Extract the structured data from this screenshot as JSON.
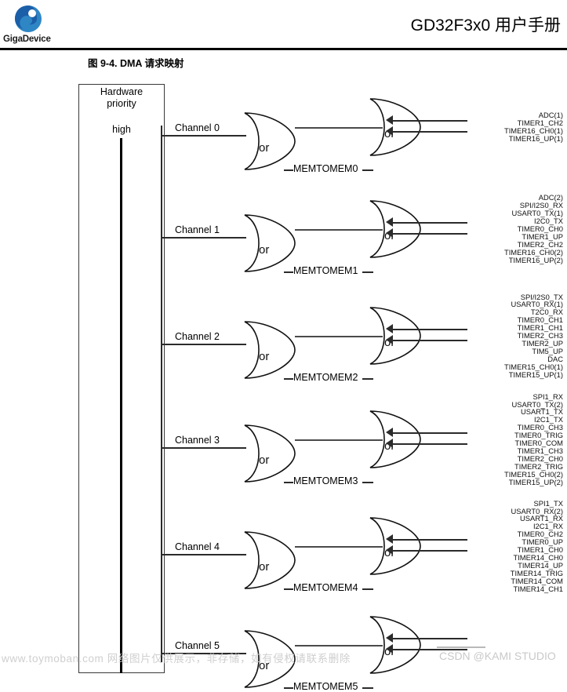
{
  "header": {
    "logo_name": "GigaDevice",
    "logo_icon": "gigadevice-swirl-logo",
    "doc_title": "GD32F3x0 用户手册",
    "figure_caption": "图 9-4. DMA 请求映射",
    "brand_blue": "#1b6fb5",
    "brand_blue_light": "#3e9fd6"
  },
  "priority_box": {
    "title_line1": "Hardware",
    "title_line2": "priority",
    "level_label": "high"
  },
  "gate_label": "or",
  "channels": [
    {
      "name": "Channel 0",
      "memtomem": "MEMTOMEM0",
      "signals": [
        "ADC(1)",
        "TIMER1_CH2",
        "TIMER16_CH0(1)",
        "TIMER16_UP(1)"
      ]
    },
    {
      "name": "Channel 1",
      "memtomem": "MEMTOMEM1",
      "signals": [
        "ADC(2)",
        "SPI/I2S0_RX",
        "USART0_TX(1)",
        "I2C0_TX",
        "TIMER0_CH0",
        "TIMER1_UP",
        "TIMER2_CH2",
        "TIMER16_CH0(2)",
        "TIMER16_UP(2)"
      ]
    },
    {
      "name": "Channel 2",
      "memtomem": "MEMTOMEM2",
      "signals": [
        "SPI/I2S0_TX",
        "USART0_RX(1)",
        "T2C0_RX",
        "TIMER0_CH1",
        "TIMER1_CH1",
        "TIMER2_CH3",
        "TIMER2_UP",
        "TIM5_UP",
        "DAC",
        "TIMER15_CH0(1)",
        "TIMER15_UP(1)"
      ]
    },
    {
      "name": "Channel 3",
      "memtomem": "MEMTOMEM3",
      "signals": [
        "SPI1_RX",
        "USART0_TX(2)",
        "USART1_TX",
        "I2C1_TX",
        "TIMER0_CH3",
        "TIMER0_TRIG",
        "TIMER0_COM",
        "TIMER1_CH3",
        "TIMER2_CH0",
        "TIMER2_TRIG",
        "TIMER15_CH0(2)",
        "TIMER15_UP(2)"
      ]
    },
    {
      "name": "Channel 4",
      "memtomem": "MEMTOMEM4",
      "signals": [
        "SPI1_TX",
        "USART0_RX(2)",
        "USART1_RX",
        "I2C1_RX",
        "TIMER0_CH2",
        "TIMER0_UP",
        "TIMER1_CH0",
        "TIMER14_CH0",
        "TIMER14_UP",
        "TIMER14_TRIG",
        "TIMER14_COM",
        "TIMER14_CH1"
      ]
    },
    {
      "name": "Channel 5",
      "memtomem": "MEMTOMEM5",
      "signals": []
    }
  ],
  "watermarks": {
    "left": "www.toymoban.com 网络图片仅供展示，非存储，如有侵权请联系删除",
    "right": "CSDN @KAMI STUDIO"
  }
}
